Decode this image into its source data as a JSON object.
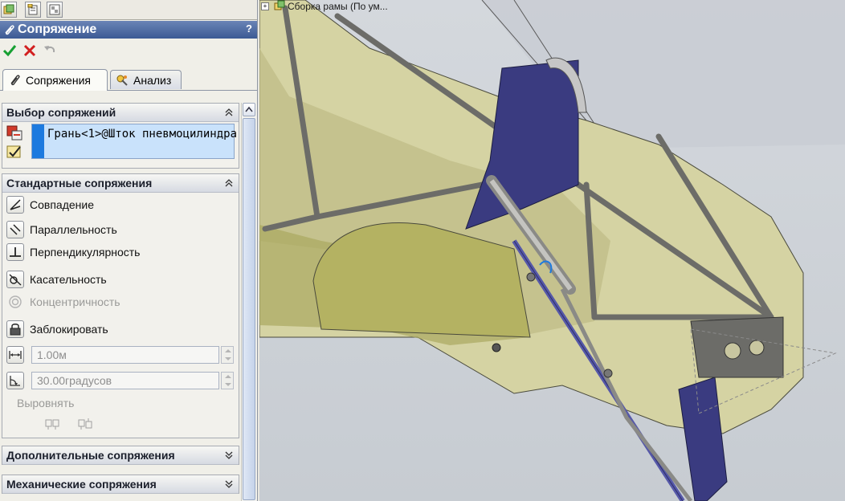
{
  "featuremanager_tabs": [
    "feature-tree-icon",
    "property-manager-icon",
    "configuration-manager-icon"
  ],
  "property_manager": {
    "title": "Сопряжение",
    "help": "?",
    "actions": [
      "ok-icon",
      "cancel-icon",
      "undo-icon"
    ],
    "tabs": [
      {
        "label": "Сопряжения",
        "icon": "paperclip-icon",
        "active": true
      },
      {
        "label": "Анализ",
        "icon": "analysis-icon",
        "active": false
      }
    ],
    "mate_selection": {
      "header": "Выбор сопряжений",
      "selection_value": "Грань<1>@Шток пневмоцилиндра"
    },
    "standard_mates": {
      "header": "Стандартные сопряжения",
      "items": [
        {
          "label": "Совпадение",
          "icon": "coincident-icon",
          "enabled": true
        },
        {
          "label": "Параллельность",
          "icon": "parallel-icon",
          "enabled": true
        },
        {
          "label": "Перпендикулярность",
          "icon": "perpendicular-icon",
          "enabled": true
        },
        {
          "label": "Касательность",
          "icon": "tangent-icon",
          "enabled": true
        },
        {
          "label": "Концентричность",
          "icon": "concentric-icon",
          "enabled": false
        },
        {
          "label": "Заблокировать",
          "icon": "lock-icon",
          "enabled": true
        }
      ],
      "distance_value": "1.00м",
      "angle_value": "30.00градусов",
      "align_label": "Выровнять"
    },
    "advanced_mates": {
      "header": "Дополнительные сопряжения"
    },
    "mechanical_mates": {
      "header": "Механические сопряжения"
    }
  },
  "viewport": {
    "tree_label": "Сборка рамы  (По ум..."
  },
  "colors": {
    "title_bar": "#4a679f",
    "fairing": "#d3d1a0",
    "bracket": "#3a3b80",
    "tube": "#6c6c68",
    "selection": "#1d7adf"
  }
}
